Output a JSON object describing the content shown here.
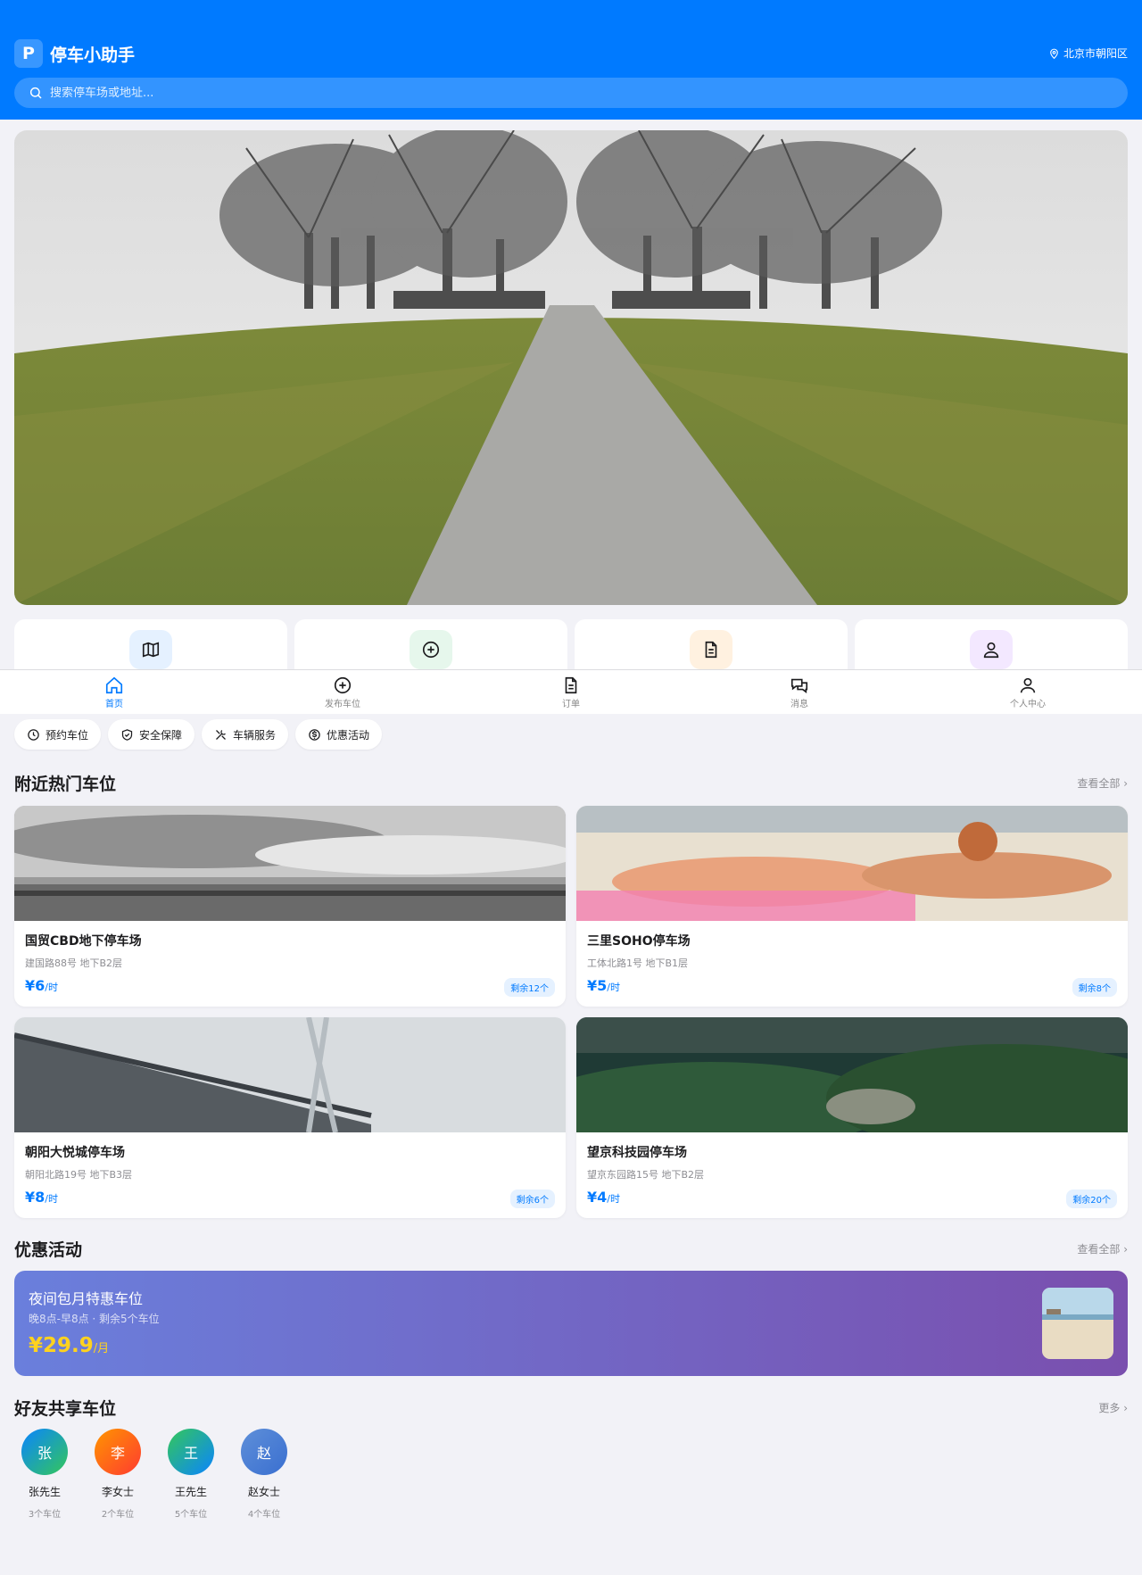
{
  "header": {
    "logo_letter": "P",
    "app_name": "停车小助手",
    "location": "北京市朝阳区",
    "search_placeholder": "搜索停车场或地址..."
  },
  "quick_actions": [
    {
      "icon": "map-icon",
      "color": "#e5f1ff"
    },
    {
      "icon": "plus-circle-icon",
      "color": "#e6f7ec"
    },
    {
      "icon": "document-icon",
      "color": "#fff1e0"
    },
    {
      "icon": "user-icon",
      "color": "#f3e8ff"
    }
  ],
  "tabbar": {
    "items": [
      {
        "label": "首页",
        "icon": "home-icon",
        "active": true
      },
      {
        "label": "发布车位",
        "icon": "plus-circle-icon"
      },
      {
        "label": "订单",
        "icon": "document-icon"
      },
      {
        "label": "消息",
        "icon": "chat-icon"
      },
      {
        "label": "个人中心",
        "icon": "user-icon"
      }
    ]
  },
  "chips": [
    {
      "label": "预约车位",
      "icon": "clock-icon"
    },
    {
      "label": "安全保障",
      "icon": "shield-icon"
    },
    {
      "label": "车辆服务",
      "icon": "tools-icon"
    },
    {
      "label": "优惠活动",
      "icon": "dollar-icon"
    }
  ],
  "nearby": {
    "title": "附近热门车位",
    "more": "查看全部 ›",
    "lots": [
      {
        "name": "国贸CBD地下停车场",
        "addr": "建国路88号 地下B2层",
        "price": "¥6",
        "unit": "/时",
        "badge": "剩余12个"
      },
      {
        "name": "三里SOHO停车场",
        "addr": "工体北路1号 地下B1层",
        "price": "¥5",
        "unit": "/时",
        "badge": "剩余8个"
      },
      {
        "name": "朝阳大悦城停车场",
        "addr": "朝阳北路19号 地下B3层",
        "price": "¥8",
        "unit": "/时",
        "badge": "剩余6个"
      },
      {
        "name": "望京科技园停车场",
        "addr": "望京东园路15号 地下B2层",
        "price": "¥4",
        "unit": "/时",
        "badge": "剩余20个"
      }
    ]
  },
  "promo": {
    "section_title": "优惠活动",
    "more": "查看全部 ›",
    "title": "夜间包月特惠车位",
    "sub": "晚8点-早8点 · 剩余5个车位",
    "price": "¥29.9",
    "unit": "/月"
  },
  "friends": {
    "title": "好友共享车位",
    "more": "更多 ›",
    "items": [
      {
        "initial": "张",
        "name": "张先生",
        "sub": "3个车位",
        "gradient": "linear-gradient(135deg,#0a84ff,#34c759)"
      },
      {
        "initial": "李",
        "name": "李女士",
        "sub": "2个车位",
        "gradient": "linear-gradient(135deg,#ff9500,#ff3b30)"
      },
      {
        "initial": "王",
        "name": "王先生",
        "sub": "5个车位",
        "gradient": "linear-gradient(135deg,#34c759,#0a84ff)"
      },
      {
        "initial": "赵",
        "name": "赵女士",
        "sub": "4个车位",
        "gradient": "linear-gradient(135deg,#5e8fd9,#3a6fd0)"
      }
    ]
  }
}
